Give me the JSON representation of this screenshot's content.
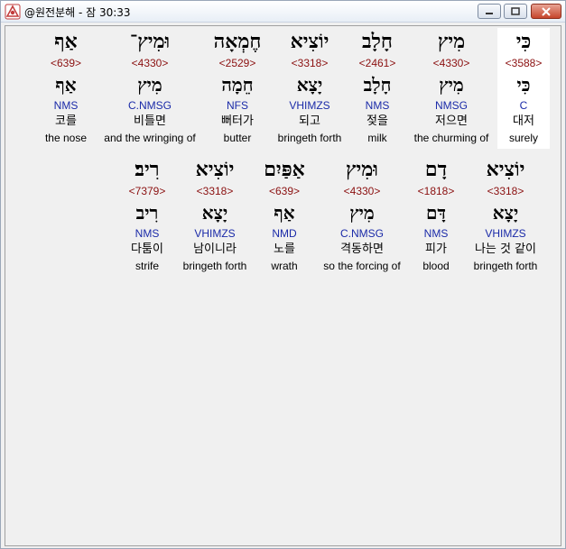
{
  "window": {
    "title": "@원전분해 - 잠 30:33"
  },
  "row1": [
    {
      "heb": "כִּי",
      "num": "<3588>",
      "lex": "כִּי",
      "parse": "C",
      "kor": "대저",
      "eng": "surely"
    },
    {
      "heb": "מִיץ",
      "num": "<4330>",
      "lex": "מִיץ",
      "parse": "NMSG",
      "kor": "저으면",
      "eng": "the churming of"
    },
    {
      "heb": "חָלָב",
      "num": "<2461>",
      "lex": "חָלָב",
      "parse": "NMS",
      "kor": "젖을",
      "eng": "milk"
    },
    {
      "heb": "יוֹצִיא",
      "num": "<3318>",
      "lex": "יָצָא",
      "parse": "VHIMZS",
      "kor": "되고",
      "eng": "bringeth forth"
    },
    {
      "heb": "חֶמְאָה",
      "num": "<2529>",
      "lex": "חֵמָה",
      "parse": "NFS",
      "kor": "뻐터가",
      "eng": "butter"
    },
    {
      "heb": "וּמִיץ־",
      "num": "<4330>",
      "lex": "מִיץ",
      "parse": "C.NMSG",
      "kor": "비틀면",
      "eng": "and the wringing of"
    },
    {
      "heb": "אַף",
      "num": "<639>",
      "lex": "אַף",
      "parse": "NMS",
      "kor": "코를",
      "eng": "the nose"
    }
  ],
  "row2": [
    {
      "heb": "יוֹצִיא",
      "num": "<3318>",
      "lex": "יָצָא",
      "parse": "VHIMZS",
      "kor": "나는 것 같이",
      "eng": "bringeth forth"
    },
    {
      "heb": "דָם",
      "num": "<1818>",
      "lex": "דָּם",
      "parse": "NMS",
      "kor": "피가",
      "eng": "blood"
    },
    {
      "heb": "וּמִיץ",
      "num": "<4330>",
      "lex": "מִיץ",
      "parse": "C.NMSG",
      "kor": "격동하면",
      "eng": "so the forcing of"
    },
    {
      "heb": "אַפַּיִם",
      "num": "<639>",
      "lex": "אַף",
      "parse": "NMD",
      "kor": "노를",
      "eng": "wrath"
    },
    {
      "heb": "יוֹצִיא",
      "num": "<3318>",
      "lex": "יָצָא",
      "parse": "VHIMZS",
      "kor": "남이니라",
      "eng": "bringeth forth"
    },
    {
      "heb": "רִיב׃",
      "num": "<7379>",
      "lex": "רִיב",
      "parse": "NMS",
      "kor": "다툼이",
      "eng": "strife"
    }
  ]
}
